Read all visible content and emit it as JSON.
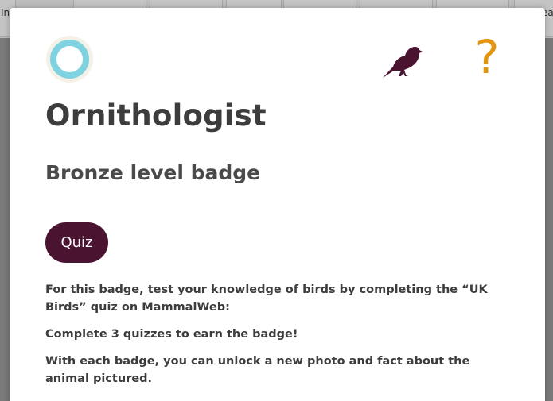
{
  "background_page": {
    "tabs": [
      {
        "label": "In"
      },
      {
        "label": ""
      },
      {
        "label": ""
      },
      {
        "label": ""
      },
      {
        "label": ""
      },
      {
        "label": ""
      },
      {
        "label": ""
      },
      {
        "label": "ea"
      }
    ]
  },
  "modal": {
    "title": "Ornithologist",
    "subtitle": "Bronze level badge",
    "quiz_button_label": "Quiz",
    "help_glyph": "?",
    "paragraphs": [
      "For this badge, test your knowledge of birds by completing the “UK Birds” quiz on MammalWeb:",
      "Complete 3 quizzes to earn the badge!",
      "With each badge, you can unlock a new photo and fact about the animal pictured."
    ]
  },
  "colors": {
    "accent": "#4a1431",
    "ring": "#7fd3e0",
    "help": "#e3950e",
    "bird": "#4a1431",
    "text": "#3d3d3d"
  },
  "icons": {
    "badge": "ring-icon",
    "category": "bird-icon",
    "help": "question-mark-icon"
  }
}
